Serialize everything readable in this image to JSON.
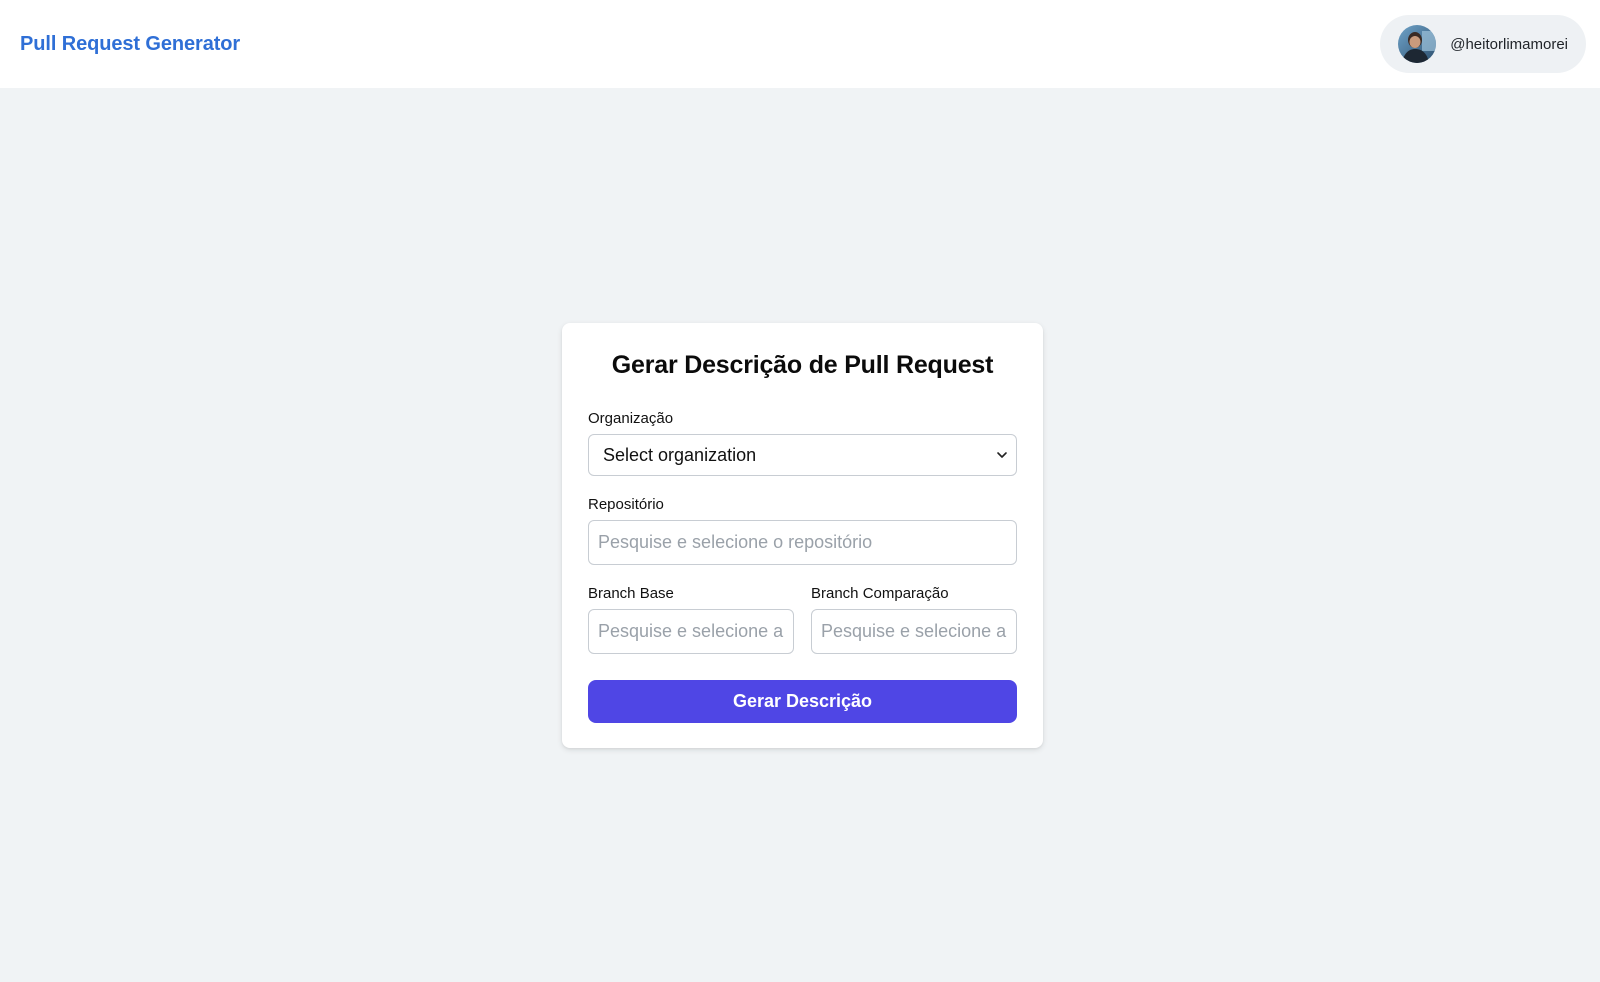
{
  "header": {
    "brand": "Pull Request Generator",
    "user": {
      "username": "@heitorlimamorei",
      "avatar_icon": "user-avatar"
    }
  },
  "form": {
    "title": "Gerar Descrição de Pull Request",
    "organization": {
      "label": "Organização",
      "selected": "Select organization",
      "icon": "chevron-down-icon"
    },
    "repository": {
      "label": "Repositório",
      "placeholder": "Pesquise e selecione o repositório",
      "value": ""
    },
    "branch_base": {
      "label": "Branch Base",
      "placeholder": "Pesquise e selecione a branch",
      "value": ""
    },
    "branch_compare": {
      "label": "Branch Comparação",
      "placeholder": "Pesquise e selecione a branch",
      "value": ""
    },
    "submit_label": "Gerar Descrição"
  },
  "colors": {
    "brand": "#2f6fd6",
    "primary_button": "#4f46e5",
    "page_background": "#f0f3f5"
  }
}
